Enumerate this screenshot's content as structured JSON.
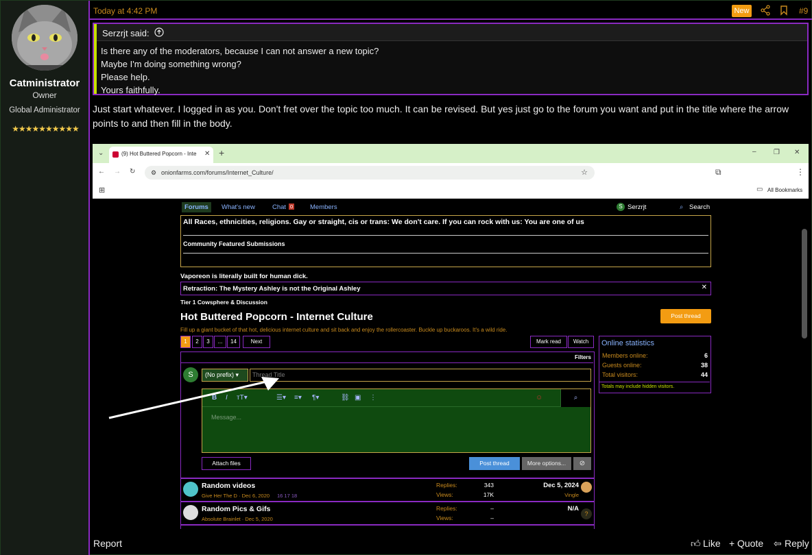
{
  "user": {
    "name": "Catministrator",
    "role": "Owner",
    "title": "Global Administrator",
    "stars": "★★★★★★★★★★"
  },
  "post": {
    "date": "Today at 4:42 PM",
    "badge": "New",
    "number": "#9",
    "quote_author": "Serzrjt said:",
    "quote_lines": [
      "Is there any of the moderators, because I can not answer a new topic?",
      "Maybe I'm doing something wrong?",
      "Please help.",
      "Yours faithfully."
    ],
    "body": "Just start whatever. I logged in as you. Don't fret over the topic too much. It can be revised. But yes just go to the forum you want and put in the title where the arrow points to and then fill in the body."
  },
  "screenshot": {
    "tab_title": "(9) Hot Buttered Popcorn - Inte",
    "url": "onionfarms.com/forums/Internet_Culture/",
    "bookmarks": "All Bookmarks",
    "nav": {
      "forums": "Forums",
      "whats_new": "What's new",
      "chat": "Chat",
      "chat_count": "0",
      "members": "Members",
      "user": "Serzrjt",
      "search": "Search"
    },
    "notice_main": "All Races, ethnicities, religions. Gay or straight, cis or trans: We don't care. If you can rock with us: You are one of us",
    "notice_featured": "Community Featured Submissions",
    "line_vaporeon": "Vaporeon is literally built for human dick.",
    "retraction": "Retraction: The Mystery Ashley is not the Original Ashley",
    "breadcrumb": "Tier 1 Cowsphere & Discussion",
    "forum_title": "Hot Buttered Popcorn - Internet Culture",
    "forum_desc": "Fill up a giant bucket of that hot, delicious internet culture and sit back and enjoy the rollercoaster. Buckle up buckaroos. It's a wild ride.",
    "post_thread": "Post thread",
    "pages": [
      "1",
      "2",
      "3",
      "...",
      "14"
    ],
    "next": "Next",
    "mark_read": "Mark read",
    "watch": "Watch",
    "filters": "Filters",
    "prefix": "(No prefix)",
    "title_placeholder": "Thread Title",
    "message_placeholder": "Message...",
    "attach": "Attach files",
    "more_options": "More options...",
    "stats": {
      "heading": "Online statistics",
      "members_label": "Members online:",
      "members": "6",
      "guests_label": "Guests online:",
      "guests": "38",
      "total_label": "Total visitors:",
      "total": "44",
      "note": "Totals may include hidden visitors."
    },
    "threads": [
      {
        "title": "Random videos",
        "meta": "Give Her The D · Dec 6, 2020",
        "pages": "16  17  18",
        "replies_label": "Replies:",
        "replies": "343",
        "views_label": "Views:",
        "views": "17K",
        "date": "Dec 5, 2024",
        "user": "Vingle"
      },
      {
        "title": "Random Pics & Gifs",
        "meta": "Absolute Brainlet · Dec 5, 2020",
        "replies_label": "Replies:",
        "replies": "–",
        "views_label": "Views:",
        "views": "–",
        "date": "N/A",
        "user": ""
      }
    ]
  },
  "footer": {
    "report": "Report",
    "like": "Like",
    "quote": "Quote",
    "reply": "Reply"
  }
}
